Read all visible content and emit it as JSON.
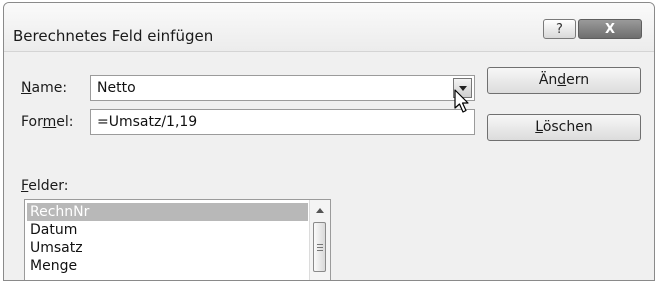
{
  "window": {
    "title": "Berechnetes Feld einfügen",
    "help_label": "?",
    "close_label": "X"
  },
  "name": {
    "label_accel": "N",
    "label_rest": "ame:",
    "value": "Netto"
  },
  "formula": {
    "label_pre": "For",
    "label_accel": "m",
    "label_post": "el:",
    "value": "=Umsatz/1,19"
  },
  "buttons": {
    "change_pre": "Än",
    "change_accel": "d",
    "change_post": "ern",
    "delete_accel": "L",
    "delete_rest": "öschen"
  },
  "fields": {
    "label_accel": "F",
    "label_rest": "elder:",
    "items": [
      "RechnNr",
      "Datum",
      "Umsatz",
      "Menge"
    ]
  }
}
